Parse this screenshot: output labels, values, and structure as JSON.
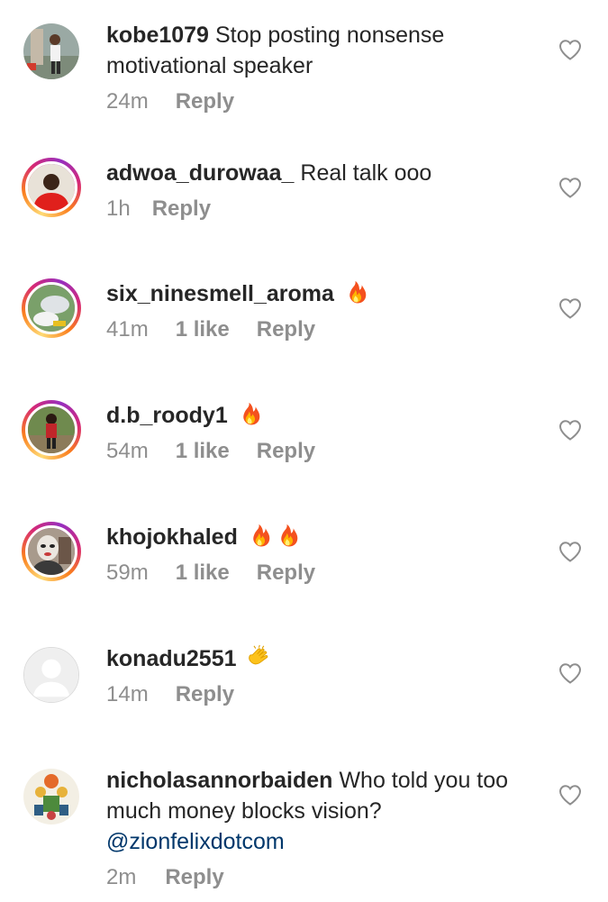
{
  "comments": [
    {
      "username": "kobe1079",
      "text": "Stop posting nonsense motivational speaker",
      "time": "24m",
      "likes": "",
      "reply_label": "Reply",
      "avatar_icon": "person-photo-avatar",
      "story_ring": false
    },
    {
      "username": "adwoa_durowaa_",
      "text": "Real talk ooo",
      "time": "1h",
      "likes": "",
      "reply_label": "Reply",
      "avatar_icon": "person-red-shirt-avatar",
      "story_ring": true
    },
    {
      "username": "six_ninesmell_aroma",
      "text": "🔥",
      "time": "41m",
      "likes": "1 like",
      "reply_label": "Reply",
      "avatar_icon": "sneakers-photo-avatar",
      "story_ring": true
    },
    {
      "username": "d.b_roody1",
      "text": "🔥",
      "time": "54m",
      "likes": "1 like",
      "reply_label": "Reply",
      "avatar_icon": "person-outdoors-avatar",
      "story_ring": true
    },
    {
      "username": "khojokhaled",
      "text": "🔥🔥",
      "time": "59m",
      "likes": "1 like",
      "reply_label": "Reply",
      "avatar_icon": "masked-person-avatar",
      "story_ring": true
    },
    {
      "username": "konadu2551",
      "text": "👏",
      "time": "14m",
      "likes": "",
      "reply_label": "Reply",
      "avatar_icon": "default-user-avatar",
      "story_ring": false
    },
    {
      "username": "nicholasannorbaiden",
      "text": "Who told you too much money blocks vision?",
      "mention": "@zionfelixdotcom",
      "time": "2m",
      "likes": "",
      "reply_label": "Reply",
      "avatar_icon": "illustrated-figures-avatar",
      "story_ring": false
    }
  ],
  "colors": {
    "text": "#262626",
    "meta": "#8e8e8e",
    "mention": "#00376b",
    "heart_outline": "#8e8e8e"
  }
}
